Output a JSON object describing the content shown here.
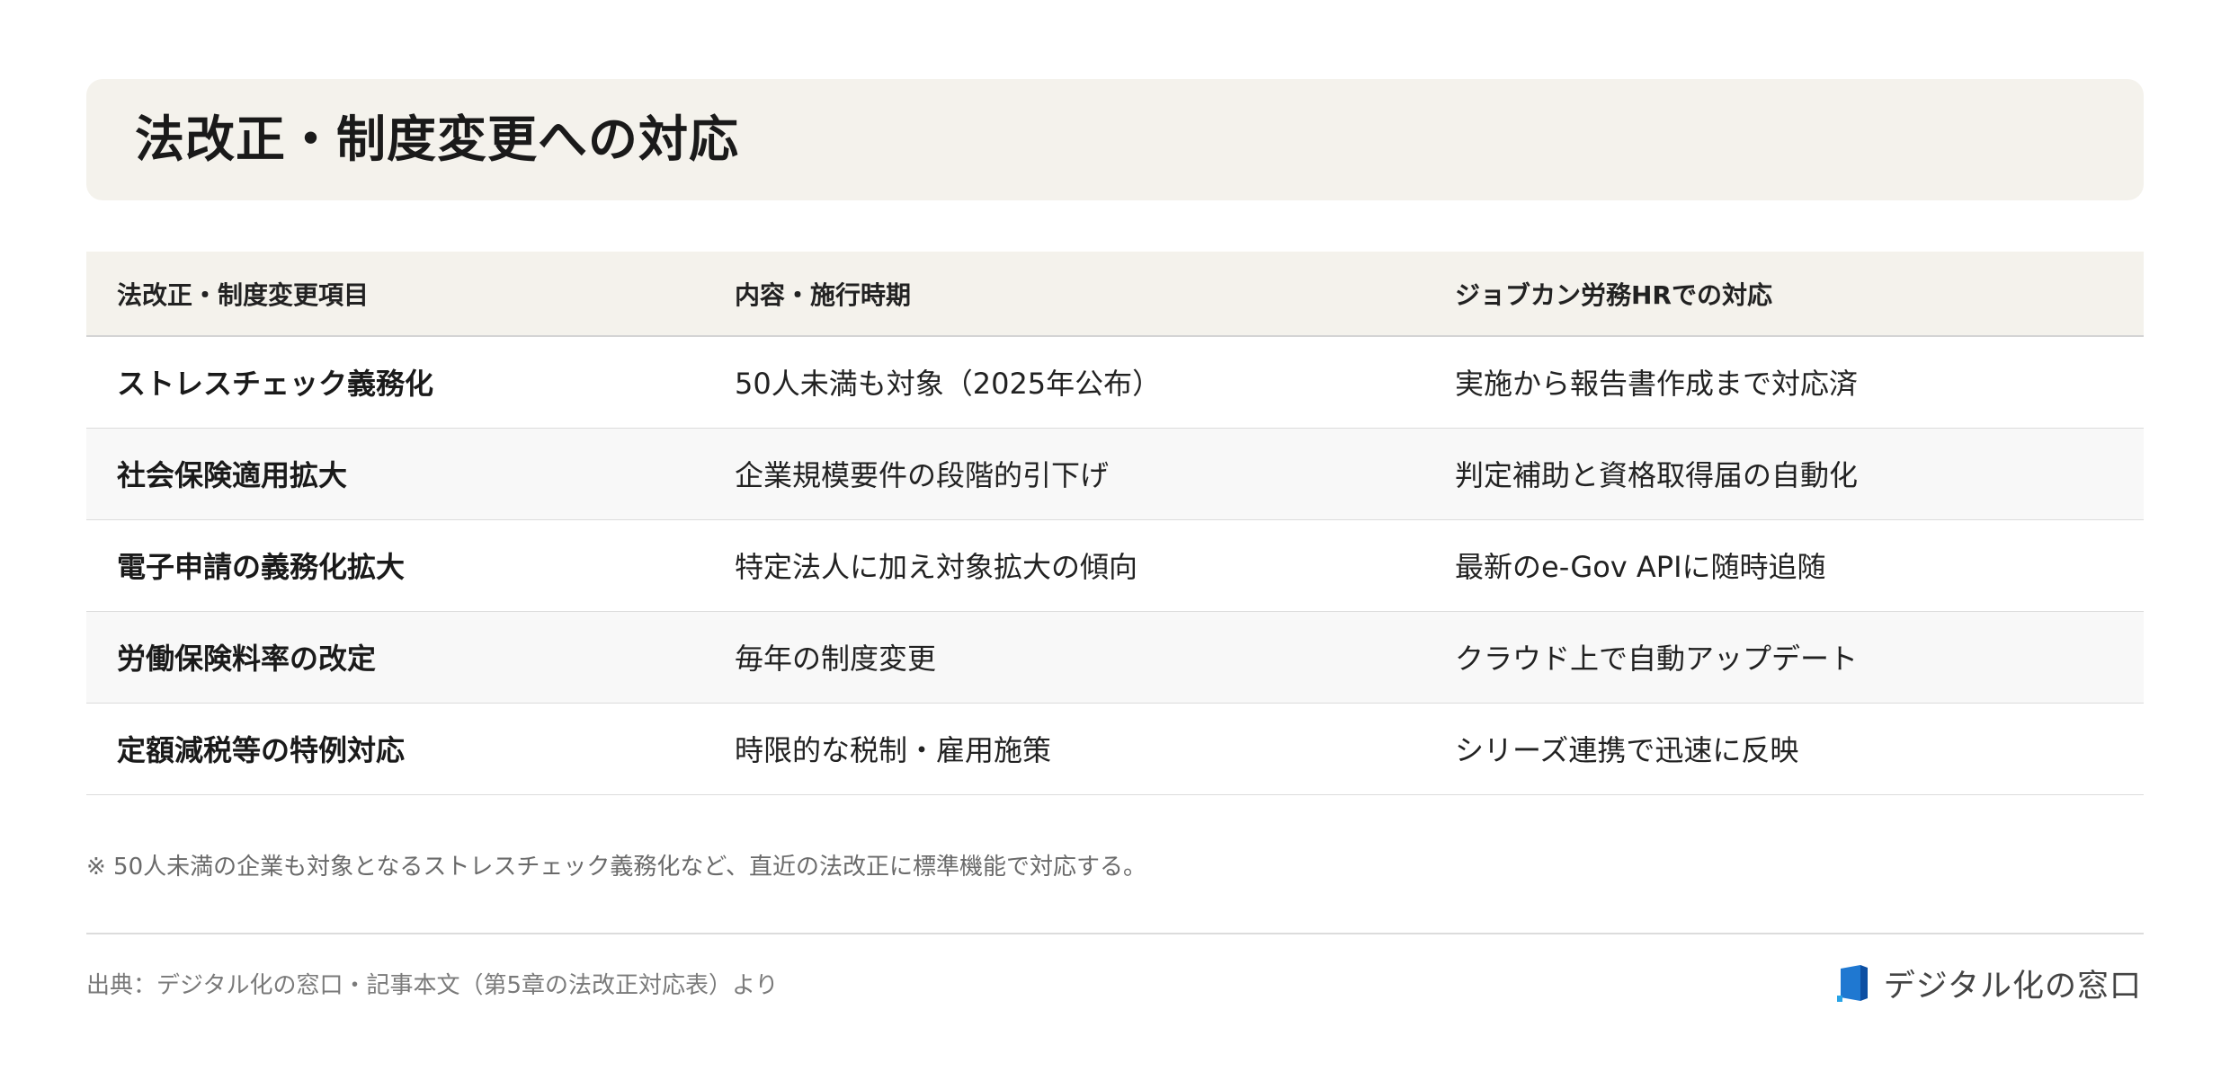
{
  "title": "法改正・制度変更への対応",
  "table": {
    "headers": [
      "法改正・制度変更項目",
      "内容・施行時期",
      "ジョブカン労務HRでの対応"
    ],
    "rows": [
      [
        "ストレスチェック義務化",
        "50人未満も対象（2025年公布）",
        "実施から報告書作成まで対応済"
      ],
      [
        "社会保険適用拡大",
        "企業規模要件の段階的引下げ",
        "判定補助と資格取得届の自動化"
      ],
      [
        "電子申請の義務化拡大",
        "特定法人に加え対象拡大の傾向",
        "最新のe-Gov APIに随時追随"
      ],
      [
        "労働保険料率の改定",
        "毎年の制度変更",
        "クラウド上で自動アップデート"
      ],
      [
        "定額減税等の特例対応",
        "時限的な税制・雇用施策",
        "シリーズ連携で迅速に反映"
      ]
    ]
  },
  "note": "※ 50人未満の企業も対象となるストレスチェック義務化など、直近の法改正に標準機能で対応する。",
  "source": "出典：デジタル化の窓口・記事本文（第5章の法改正対応表）より",
  "brand": {
    "name": "デジタル化の窓口",
    "logo_icon": "brand-logo-icon",
    "logo_colors": [
      "#1f78d1",
      "#0d4fa3"
    ]
  }
}
